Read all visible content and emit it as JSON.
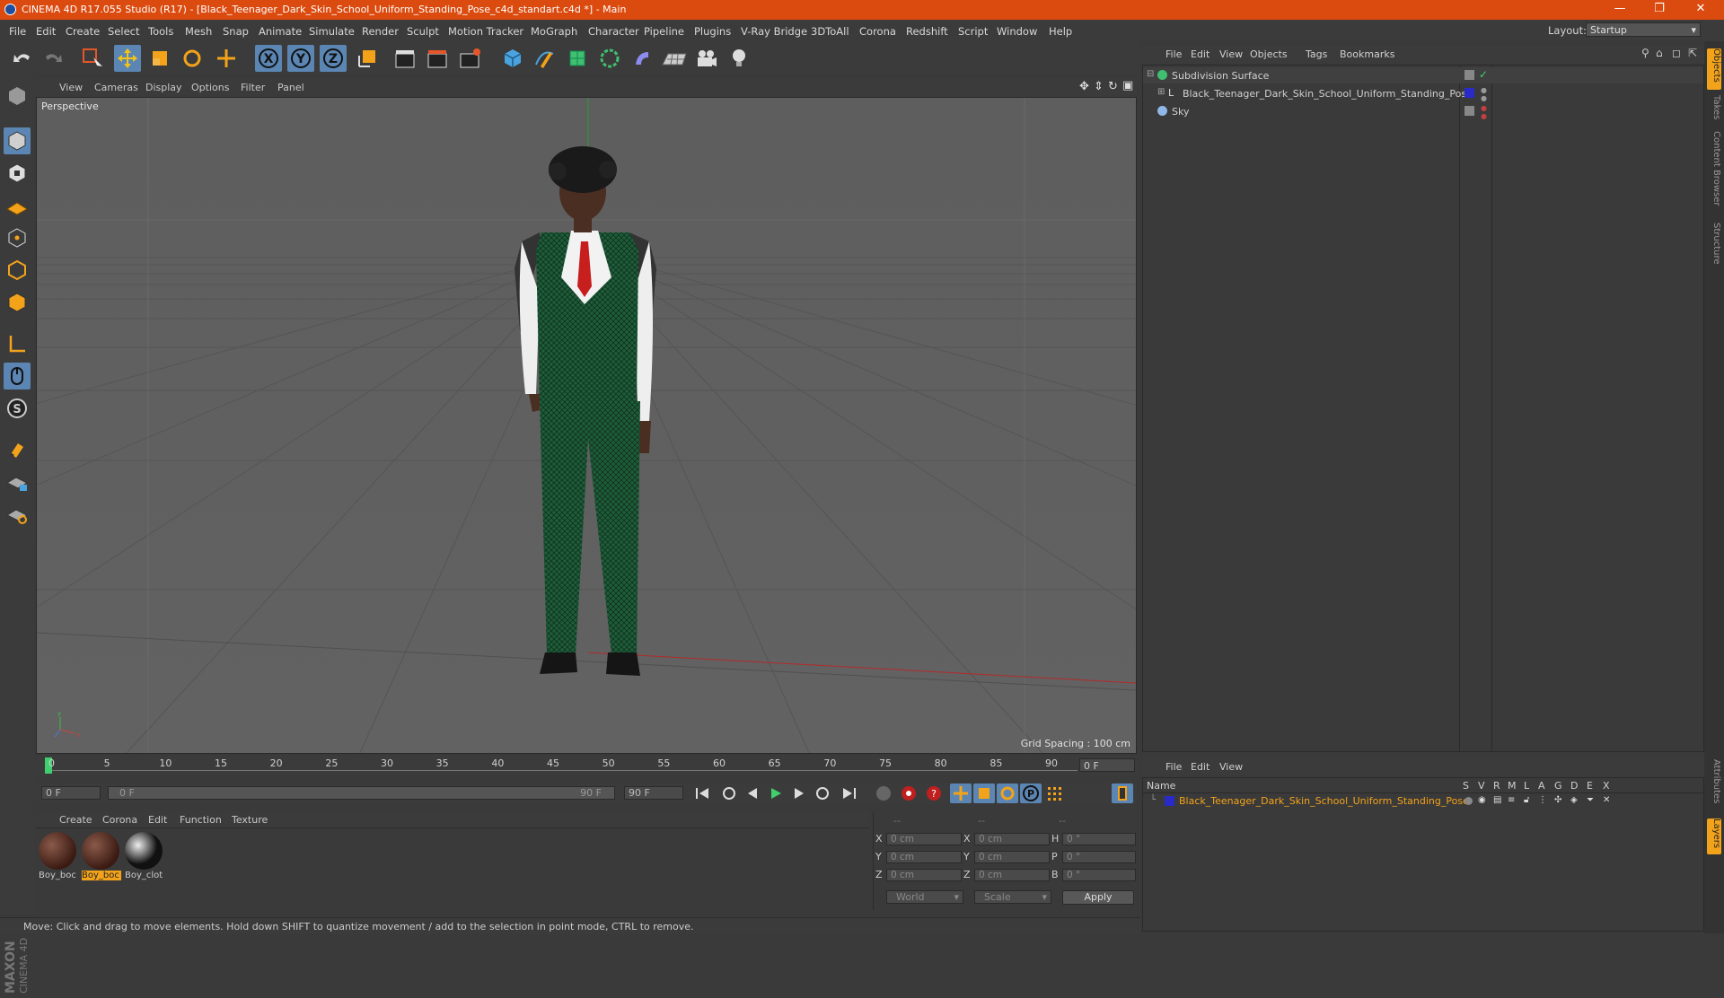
{
  "window": {
    "title": "CINEMA 4D R17.055 Studio (R17) - [Black_Teenager_Dark_Skin_School_Uniform_Standing_Pose_c4d_standart.c4d *] - Main",
    "minimize": "—",
    "restore": "❐",
    "close": "✕"
  },
  "menubar": {
    "items": [
      "File",
      "Edit",
      "Create",
      "Select",
      "Tools",
      "Mesh",
      "Snap",
      "Animate",
      "Simulate",
      "Render",
      "Sculpt",
      "Motion Tracker",
      "MoGraph",
      "Character",
      "Pipeline",
      "Plugins",
      "V-Ray Bridge",
      "3DToAll",
      "Corona",
      "Redshift",
      "Script",
      "Window",
      "Help"
    ],
    "layout_label": "Layout:",
    "layout_value": "Startup"
  },
  "viewport": {
    "menu": [
      "View",
      "Cameras",
      "Display",
      "Options",
      "Filter",
      "Panel"
    ],
    "label": "Perspective",
    "grid_spacing": "Grid Spacing : 100 cm"
  },
  "timeline": {
    "ticks": [
      "0",
      "5",
      "10",
      "15",
      "20",
      "25",
      "30",
      "35",
      "40",
      "45",
      "50",
      "55",
      "60",
      "65",
      "70",
      "75",
      "80",
      "85",
      "90"
    ],
    "end_field": "0 F",
    "current_frame": "0 F",
    "range_start": "0 F",
    "range_end": "90 F",
    "max_frame": "90 F"
  },
  "materials": {
    "menu": [
      "Create",
      "Corona",
      "Edit",
      "Function",
      "Texture"
    ],
    "items": [
      {
        "label": "Boy_boc",
        "selected": false
      },
      {
        "label": "Boy_boc",
        "selected": true
      },
      {
        "label": "Boy_clot",
        "selected": false
      }
    ]
  },
  "coordinates": {
    "header": [
      "--",
      "--",
      "--"
    ],
    "rows": [
      {
        "axis": "X",
        "pos": "0 cm",
        "axis2": "X",
        "size": "0 cm",
        "rot_label": "H",
        "rot": "0 °"
      },
      {
        "axis": "Y",
        "pos": "0 cm",
        "axis2": "Y",
        "size": "0 cm",
        "rot_label": "P",
        "rot": "0 °"
      },
      {
        "axis": "Z",
        "pos": "0 cm",
        "axis2": "Z",
        "size": "0 cm",
        "rot_label": "B",
        "rot": "0 °"
      }
    ],
    "mode1": "World",
    "mode2": "Scale",
    "apply": "Apply"
  },
  "status": "Move: Click and drag to move elements. Hold down SHIFT to quantize movement / add to the selection in point mode, CTRL to remove.",
  "object_manager": {
    "menu": [
      "File",
      "Edit",
      "View",
      "Objects",
      "Tags",
      "Bookmarks"
    ],
    "objects": [
      {
        "name": "Subdivision Surface",
        "indent": 0
      },
      {
        "name": "Black_Teenager_Dark_Skin_School_Uniform_Standing_Pose",
        "indent": 1
      },
      {
        "name": "Sky",
        "indent": 0
      }
    ]
  },
  "layer_manager": {
    "menu": [
      "File",
      "Edit",
      "View"
    ],
    "columns": [
      "Name",
      "S",
      "V",
      "R",
      "M",
      "L",
      "A",
      "G",
      "D",
      "E",
      "X"
    ],
    "layer_name": "Black_Teenager_Dark_Skin_School_Uniform_Standing_Pose"
  },
  "right_tabs": [
    "Objects",
    "Takes",
    "Content Browser",
    "Structure",
    "Attributes",
    "Layers"
  ],
  "brand": {
    "line1": "MAXON",
    "line2": "CINEMA 4D"
  },
  "colors": {
    "titlebar": "#db4b0f",
    "accent": "#f3a31a",
    "selected_tool": "#5b86b3"
  }
}
